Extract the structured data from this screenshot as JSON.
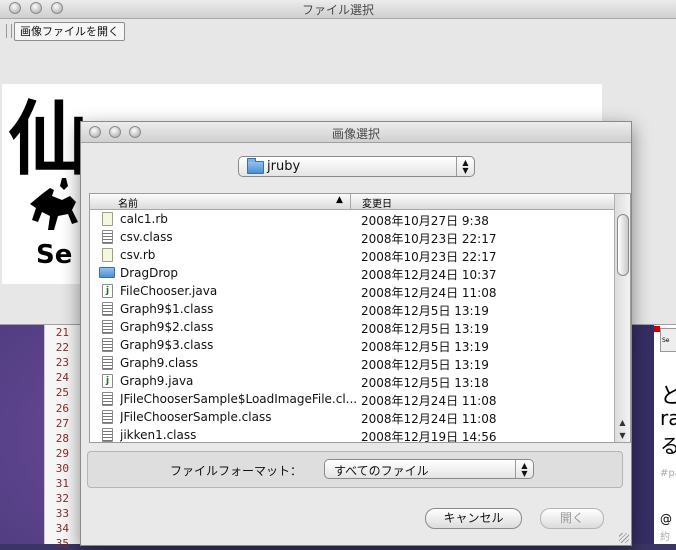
{
  "back_window": {
    "title": "ファイル選択",
    "open_image_button": "画像ファイルを開く",
    "image_logo_char": "仙",
    "image_logo_sub": "Se"
  },
  "editor": {
    "line_numbers": [
      "21",
      "22",
      "23",
      "24",
      "25",
      "26",
      "27",
      "28",
      "29",
      "30",
      "31",
      "32",
      "33",
      "34",
      "35"
    ]
  },
  "right_pane": {
    "icon_text": "Se",
    "big_text_1": "と",
    "big_text_2": "ra",
    "big_text_3": "る",
    "small_text": "#pa",
    "at_text": "@",
    "small_text_2": "約"
  },
  "dialog": {
    "title": "画像選択",
    "folder": "jruby",
    "columns": {
      "name": "名前",
      "modified": "変更日"
    },
    "files": [
      {
        "name": "calc1.rb",
        "date": "2008年10月27日 9:38",
        "icon": "ruby-file-icon"
      },
      {
        "name": "csv.class",
        "date": "2008年10月23日 22:17",
        "icon": "class-file-icon"
      },
      {
        "name": "csv.rb",
        "date": "2008年10月23日 22:17",
        "icon": "ruby-file-icon"
      },
      {
        "name": "DragDrop",
        "date": "2008年12月24日 10:37",
        "icon": "folder-icon"
      },
      {
        "name": "FileChooser.java",
        "date": "2008年12月24日 11:08",
        "icon": "java-file-icon"
      },
      {
        "name": "Graph9$1.class",
        "date": "2008年12月5日 13:19",
        "icon": "class-file-icon"
      },
      {
        "name": "Graph9$2.class",
        "date": "2008年12月5日 13:19",
        "icon": "class-file-icon"
      },
      {
        "name": "Graph9$3.class",
        "date": "2008年12月5日 13:19",
        "icon": "class-file-icon"
      },
      {
        "name": "Graph9.class",
        "date": "2008年12月5日 13:19",
        "icon": "class-file-icon"
      },
      {
        "name": "Graph9.java",
        "date": "2008年12月5日 13:18",
        "icon": "java-file-icon"
      },
      {
        "name": "JFileChooserSample$LoadImageFile.cl...",
        "date": "2008年12月24日 11:08",
        "icon": "class-file-icon"
      },
      {
        "name": "JFileChooserSample.class",
        "date": "2008年12月24日 11:08",
        "icon": "class-file-icon"
      },
      {
        "name": "jikken1.class",
        "date": "2008年12月19日 14:56",
        "icon": "class-file-icon"
      }
    ],
    "format_label": "ファイルフォーマット：",
    "format_value": "すべてのファイル",
    "cancel_label": "キャンセル",
    "open_label": "開く"
  }
}
